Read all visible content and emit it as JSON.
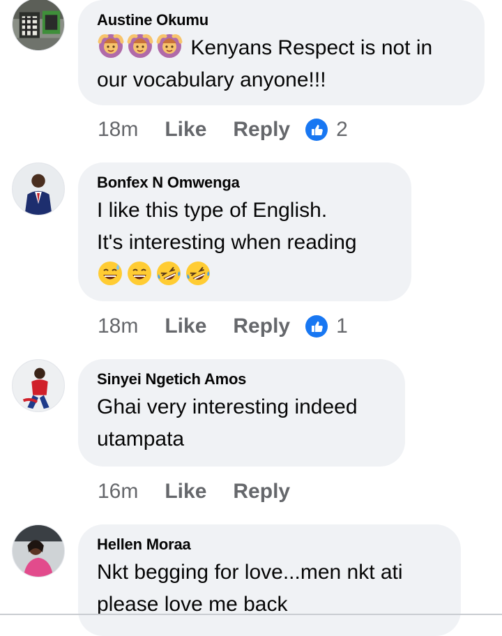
{
  "comments": [
    {
      "author": "Austine Okumu",
      "text": "Kenyans Respect is not in\nour vocabulary anyone!!!",
      "leading_emojis": [
        "person-gesturing-ok-icon",
        "person-gesturing-ok-icon",
        "person-gesturing-ok-icon"
      ],
      "time": "18m",
      "like_label": "Like",
      "reply_label": "Reply",
      "reaction_count": "2"
    },
    {
      "author": "Bonfex N Omwenga",
      "text": "I like this type of English.\nIt's interesting when reading",
      "trailing_emojis": [
        "grinning-sweat-icon",
        "grinning-squint-icon",
        "rolling-laughing-icon",
        "rolling-laughing-icon"
      ],
      "time": "18m",
      "like_label": "Like",
      "reply_label": "Reply",
      "reaction_count": "1"
    },
    {
      "author": "Sinyei Ngetich Amos",
      "text": "Ghai very interesting indeed\nutampata",
      "time": "16m",
      "like_label": "Like",
      "reply_label": "Reply"
    },
    {
      "author": "Hellen Moraa",
      "text": "Nkt begging for love...men nkt ati\nplease love me back"
    }
  ],
  "colors": {
    "bubble": "#f0f2f5",
    "meta_text": "#65676b",
    "like_blue": "#1877f2"
  }
}
